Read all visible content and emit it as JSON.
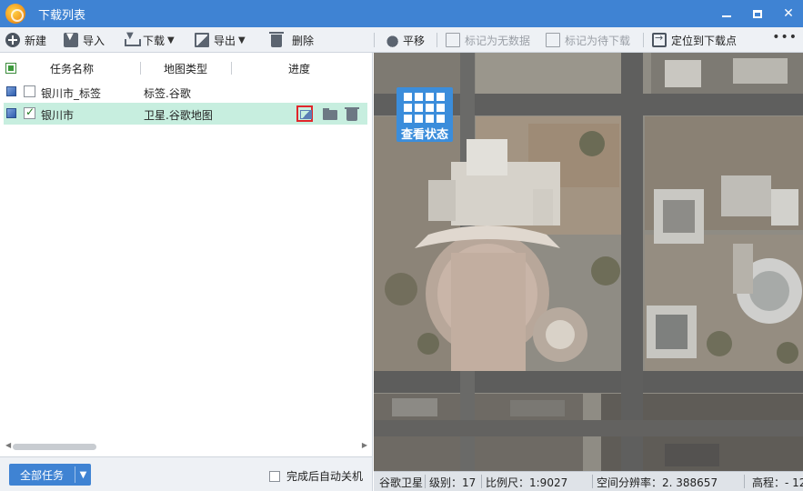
{
  "window": {
    "title": "下载列表",
    "logo_icon": "globe-logo-icon",
    "controls": {
      "minimize_icon": "minimize-icon",
      "maximize_icon": "maximize-icon",
      "close_glyph": "✕"
    }
  },
  "toolbar": {
    "new_label": "新建",
    "import_label": "导入",
    "download_label": "下载",
    "export_label": "导出",
    "delete_label": "删除",
    "pan_label": "平移",
    "mark_nodata_label": "标记为无数据",
    "mark_pending_label": "标记为待下载",
    "locate_label": "定位到下载点",
    "more_glyph": "•••",
    "dropdown_glyph": "▼"
  },
  "task_list": {
    "columns": {
      "name": "任务名称",
      "map_type": "地图类型",
      "progress": "进度"
    },
    "rows": [
      {
        "name": "银川市_标签",
        "map_type": "标签.谷歌",
        "checked": false,
        "selected": false
      },
      {
        "name": "银川市",
        "map_type": "卫星.谷歌地图",
        "checked": true,
        "selected": true
      }
    ],
    "row_actions": [
      "preview-image-icon",
      "folder-icon",
      "trash-icon"
    ]
  },
  "bottom_bar": {
    "all_tasks_label": "全部任务",
    "auto_shutdown_label": "完成后自动关机",
    "auto_shutdown_checked": false
  },
  "map": {
    "view_status_label": "查看状态",
    "status": {
      "source": "谷歌卫星",
      "level": "级别：17",
      "scale": "比例尺：1:9027",
      "resolution": "空间分辨率：2. 388657",
      "elevation": "高程：- 12"
    }
  },
  "colors": {
    "title_bar": "#3f83d3",
    "selected_row": "#c7eedf",
    "highlight_border": "#e0262b"
  }
}
